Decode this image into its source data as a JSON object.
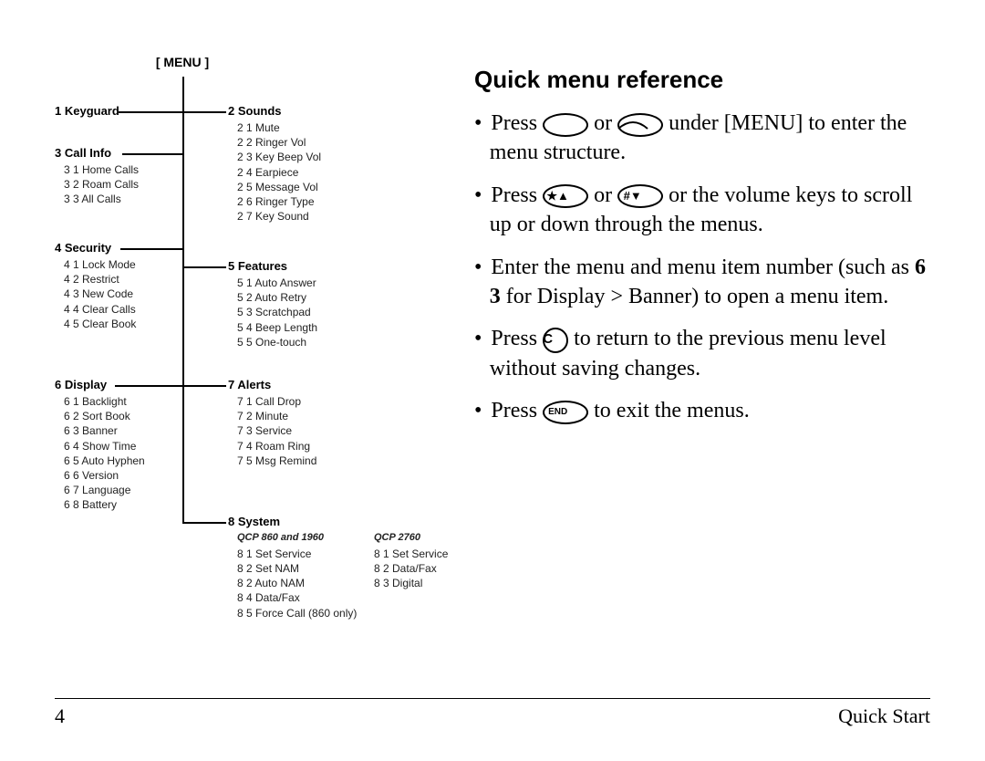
{
  "footer": {
    "page_num": "4",
    "section": "Quick Start"
  },
  "title": "Quick menu reference",
  "instructions": {
    "i1_a": " Press ",
    "i1_b": " or ",
    "i1_c": " under [MENU] to enter the menu structure.",
    "i2_a": "Press ",
    "i2_b": " or ",
    "i2_c": " or the volume keys to scroll up or down through the menus.",
    "i3_a": "Enter the menu and menu item number (such as ",
    "i3_b": "6 3",
    "i3_c": " for Display > Banner) to open a menu item.",
    "i4_a": "Press ",
    "i4_b": " to return to the previous menu level without saving changes.",
    "i5_a": "Press ",
    "i5_b": " to exit the menus."
  },
  "keys": {
    "star_up": "★▲",
    "hash_down": "#▼",
    "c": "C",
    "end": "END"
  },
  "menu": {
    "root": "[ MENU ]",
    "n1": {
      "head": "1 Keyguard"
    },
    "n2": {
      "head": "2 Sounds",
      "items": [
        "2 1 Mute",
        "2 2 Ringer Vol",
        "2 3 Key Beep Vol",
        "2 4 Earpiece",
        "2 5 Message Vol",
        "2 6 Ringer Type",
        "2 7 Key Sound"
      ]
    },
    "n3": {
      "head": "3 Call Info",
      "items": [
        "3 1 Home Calls",
        "3 2 Roam Calls",
        "3 3 All Calls"
      ]
    },
    "n4": {
      "head": "4 Security",
      "items": [
        "4 1 Lock Mode",
        "4 2 Restrict",
        "4 3 New Code",
        "4 4 Clear Calls",
        "4 5 Clear Book"
      ]
    },
    "n5": {
      "head": "5 Features",
      "items": [
        "5 1 Auto Answer",
        "5 2 Auto Retry",
        "5 3 Scratchpad",
        "5 4 Beep Length",
        "5 5 One-touch"
      ]
    },
    "n6": {
      "head": "6 Display",
      "items": [
        "6 1 Backlight",
        "6 2 Sort Book",
        "6 3 Banner",
        "6 4 Show Time",
        "6 5 Auto Hyphen",
        "6 6 Version",
        "6 7 Language",
        "6 8 Battery"
      ]
    },
    "n7": {
      "head": "7 Alerts",
      "items": [
        "7 1 Call Drop",
        "7 2 Minute",
        "7 3 Service",
        "7 4 Roam Ring",
        "7 5 Msg Remind"
      ]
    },
    "n8": {
      "head": "8 System",
      "model_a": "QCP 860 and 1960",
      "items_a": [
        "8 1 Set Service",
        "8 2 Set NAM",
        "8 2 Auto NAM",
        "8 4 Data/Fax",
        "8 5 Force Call (860 only)"
      ],
      "model_b": "QCP 2760",
      "items_b": [
        "8 1 Set Service",
        "8 2 Data/Fax",
        "8 3 Digital"
      ]
    }
  }
}
